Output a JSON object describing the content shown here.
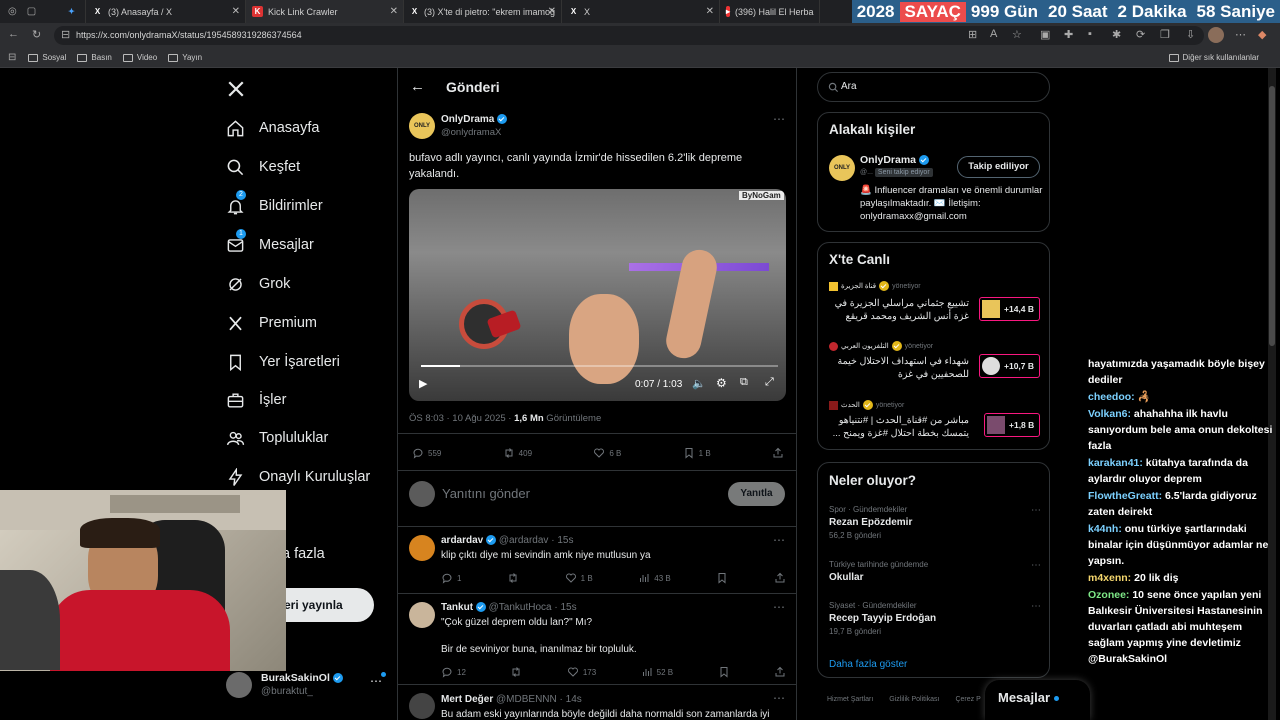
{
  "browser": {
    "tabs": [
      {
        "title": "",
        "icon": "pin-icon"
      },
      {
        "title": "(3) Anasayfa / X",
        "icon": "x-logo-icon"
      },
      {
        "title": "Kick Link Crawler",
        "icon": "kick-icon"
      },
      {
        "title": "(3) X'te di pietro: \"ekrem imamoğ",
        "icon": "x-logo-icon"
      },
      {
        "title": "X",
        "icon": "x-logo-icon"
      },
      {
        "title": "(396) Halil El Herba",
        "icon": "youtube-icon"
      }
    ],
    "url": "https://x.com/onlydramaX/status/1954589319286374564",
    "bookmarks": [
      "Sosyal",
      "Basın",
      "Video",
      "Yayın"
    ],
    "other_bookmarks": "Diğer sık kullanılanlar"
  },
  "counter": {
    "year": "2028",
    "label": "SAYAÇ",
    "days": "999 Gün",
    "hours": "20 Saat",
    "minutes": "2 Dakika",
    "seconds": "58 Saniye"
  },
  "nav": {
    "items": [
      {
        "label": "Anasayfa",
        "icon": "home-icon"
      },
      {
        "label": "Keşfet",
        "icon": "search-icon"
      },
      {
        "label": "Bildirimler",
        "icon": "bell-icon",
        "badge": "2"
      },
      {
        "label": "Mesajlar",
        "icon": "mail-icon",
        "badge": "1"
      },
      {
        "label": "Grok",
        "icon": "grok-icon"
      },
      {
        "label": "Premium",
        "icon": "x-logo-icon"
      },
      {
        "label": "Yer İşaretleri",
        "icon": "bookmark-icon"
      },
      {
        "label": "İşler",
        "icon": "briefcase-icon"
      },
      {
        "label": "Topluluklar",
        "icon": "people-icon"
      },
      {
        "label": "Onaylı Kuruluşlar",
        "icon": "lightning-icon"
      },
      {
        "label": "l",
        "icon": ""
      },
      {
        "label": "a fazla",
        "icon": ""
      }
    ],
    "post_button": "eri yayınla",
    "account": {
      "name": "BurakSakinOl",
      "handle": "@buraktut_"
    }
  },
  "main": {
    "header_title": "Gönderi",
    "tweet": {
      "author": "OnlyDrama",
      "handle": "@onlydramaX",
      "text": "bufavo adlı yayıncı, canlı yayında İzmir'de hissedilen 6.2'lik depreme yakalandı.",
      "video_watermark": "ByNoGam",
      "video_time": "0:07 / 1:03",
      "video_progress": 0.11,
      "meta_time": "ÖS 8:03 · 10 Ağu 2025 · ",
      "views_count": "1,6 Mn",
      "views_label": " Görüntüleme",
      "stats": {
        "replies": "559",
        "retweets": "409",
        "likes": "6 B",
        "bookmarks": "1 B"
      }
    },
    "reply_placeholder": "Yanıtını gönder",
    "reply_button": "Yanıtla",
    "replies": [
      {
        "name": "ardardav",
        "handle": "@ardardav",
        "time": "· 15s",
        "text": "klip çıktı diye mi sevindin amk niye mutlusun ya",
        "text2": "",
        "stats": {
          "replies": "1",
          "retweets": "",
          "likes": "1 B",
          "views": "43 B"
        }
      },
      {
        "name": "Tankut",
        "handle": "@TankutHoca",
        "time": "· 15s",
        "text": "\"Çok güzel deprem oldu lan?\" Mı?",
        "text2": "Bir de seviniyor buna, inanılmaz bir topluluk.",
        "stats": {
          "replies": "12",
          "retweets": "",
          "likes": "173",
          "views": "52 B"
        }
      },
      {
        "name": "Mert Değer",
        "handle": "@MDBENNN",
        "time": "· 14s",
        "text": "Bu adam eski yayınlarında böyle değildi daha normaldi son zamanlarda iyi",
        "text2": "",
        "stats": {}
      }
    ]
  },
  "right": {
    "search_placeholder": "Ara",
    "related": {
      "title": "Alakalı kişiler",
      "name": "OnlyDrama",
      "handle": "@...",
      "follows_you": "Seni takip ediyor",
      "follow_button": "Takip ediliyor",
      "bio": "🚨 Influencer dramaları ve önemli durumlar paylaşılmaktadır. ✉️ İletişim: onlydramaxx@gmail.com"
    },
    "live": {
      "title": "X'te Canlı",
      "items": [
        {
          "host": "قناة الجزيرة",
          "role": "yönetiyor",
          "text": "تشييع جثماني مراسلي الجزيرة في غزة أنس الشريف ومحمد قريقع",
          "count": "+14,4 B"
        },
        {
          "host": "التلفزيون العربي",
          "role": "yönetiyor",
          "text": "شهداء في استهداف الاحتلال خيمة للصحفيين في غزة",
          "count": "+10,7 B"
        },
        {
          "host": "الحدث",
          "role": "yönetiyor",
          "text": "مباشر من #قناة_الحدث | #نتنياهو يتمسك بخطة احتلال #غزة ويمنح ...",
          "count": "+1,8 B"
        }
      ]
    },
    "trends": {
      "title": "Neler oluyor?",
      "items": [
        {
          "context": "Spor · Gündemdekiler",
          "name": "Rezan Epözdemir",
          "posts": "56,2 B gönderi"
        },
        {
          "context": "Türkiye tarihinde gündemde",
          "name": "Okullar",
          "posts": ""
        },
        {
          "context": "Siyaset · Gündemdekiler",
          "name": "Recep Tayyip Erdoğan",
          "posts": "19,7 B gönderi"
        }
      ],
      "show_more": "Daha fazla göster"
    },
    "footer": [
      "Hizmet Şartları",
      "Gizlilik Politikası",
      "Çerez P"
    ],
    "messages_label": "Mesajlar"
  },
  "chat": [
    {
      "user": "",
      "text": "hayatımızda yaşamadık böyle bişey dediler",
      "color": "blue"
    },
    {
      "user": "cheedoo:",
      "text": "🦂",
      "color": "blue"
    },
    {
      "user": "Volkan6:",
      "text": "ahahahha ilk havlu sanıyordum bele ama onun dekoltesi fazla",
      "color": "blue"
    },
    {
      "user": "karakan41:",
      "text": "kütahya tarafında da aylardır oluyor deprem",
      "color": "blue"
    },
    {
      "user": "FlowtheGreatt:",
      "text": "6.5'larda gidiyoruz zaten deirekt",
      "color": "blue"
    },
    {
      "user": "k44nh:",
      "text": "onu türkiye şartlarındaki binalar için düşünmüyor adamlar ne yapsın.",
      "color": "blue"
    },
    {
      "user": "m4xenn:",
      "text": "20 lik diş",
      "color": "yellow"
    },
    {
      "user": "Ozonee:",
      "text": "10 sene önce yapılan yeni Balıkesir Üniversitesi Hastanesinin duvarları çatladı abi muhteşem sağlam yapmış yine devletimiz @BurakSakinOl",
      "color": "green"
    }
  ],
  "colors": {
    "accent": "#1d9bf0",
    "background": "#000000",
    "border": "#2f3336",
    "muted": "#71767b",
    "counter_bg": "#2b5f8a",
    "counter_hl": "#ec4c4c"
  }
}
